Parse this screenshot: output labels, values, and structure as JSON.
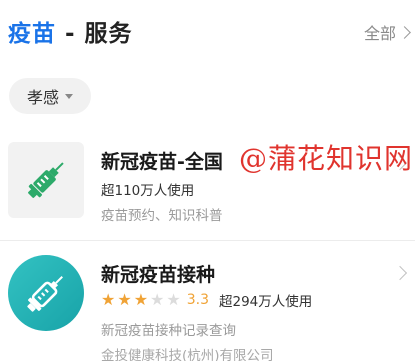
{
  "header": {
    "title_highlight": "疫苗",
    "title_rest": " - 服务",
    "all_label": "全部"
  },
  "filter": {
    "city_label": "孝感"
  },
  "services": [
    {
      "name": "新冠疫苗-全国",
      "users": "超110万人使用",
      "description": "疫苗预约、知识科普",
      "icon": "syringe-icon"
    },
    {
      "name": "新冠疫苗接种",
      "rating": {
        "value": 3.3,
        "max": 5,
        "text": "3.3"
      },
      "users": "超294万人使用",
      "description": "新冠疫苗接种记录查询",
      "company": "金投健康科技(杭州)有限公司",
      "icon": "syringe-icon"
    }
  ],
  "watermark": "@蒲花知识网",
  "colors": {
    "accent": "#1a73e8",
    "star": "#f0a336",
    "icon_green": "#2daa6a",
    "icon_teal": "#18a3a8",
    "watermark": "#e0342e"
  }
}
